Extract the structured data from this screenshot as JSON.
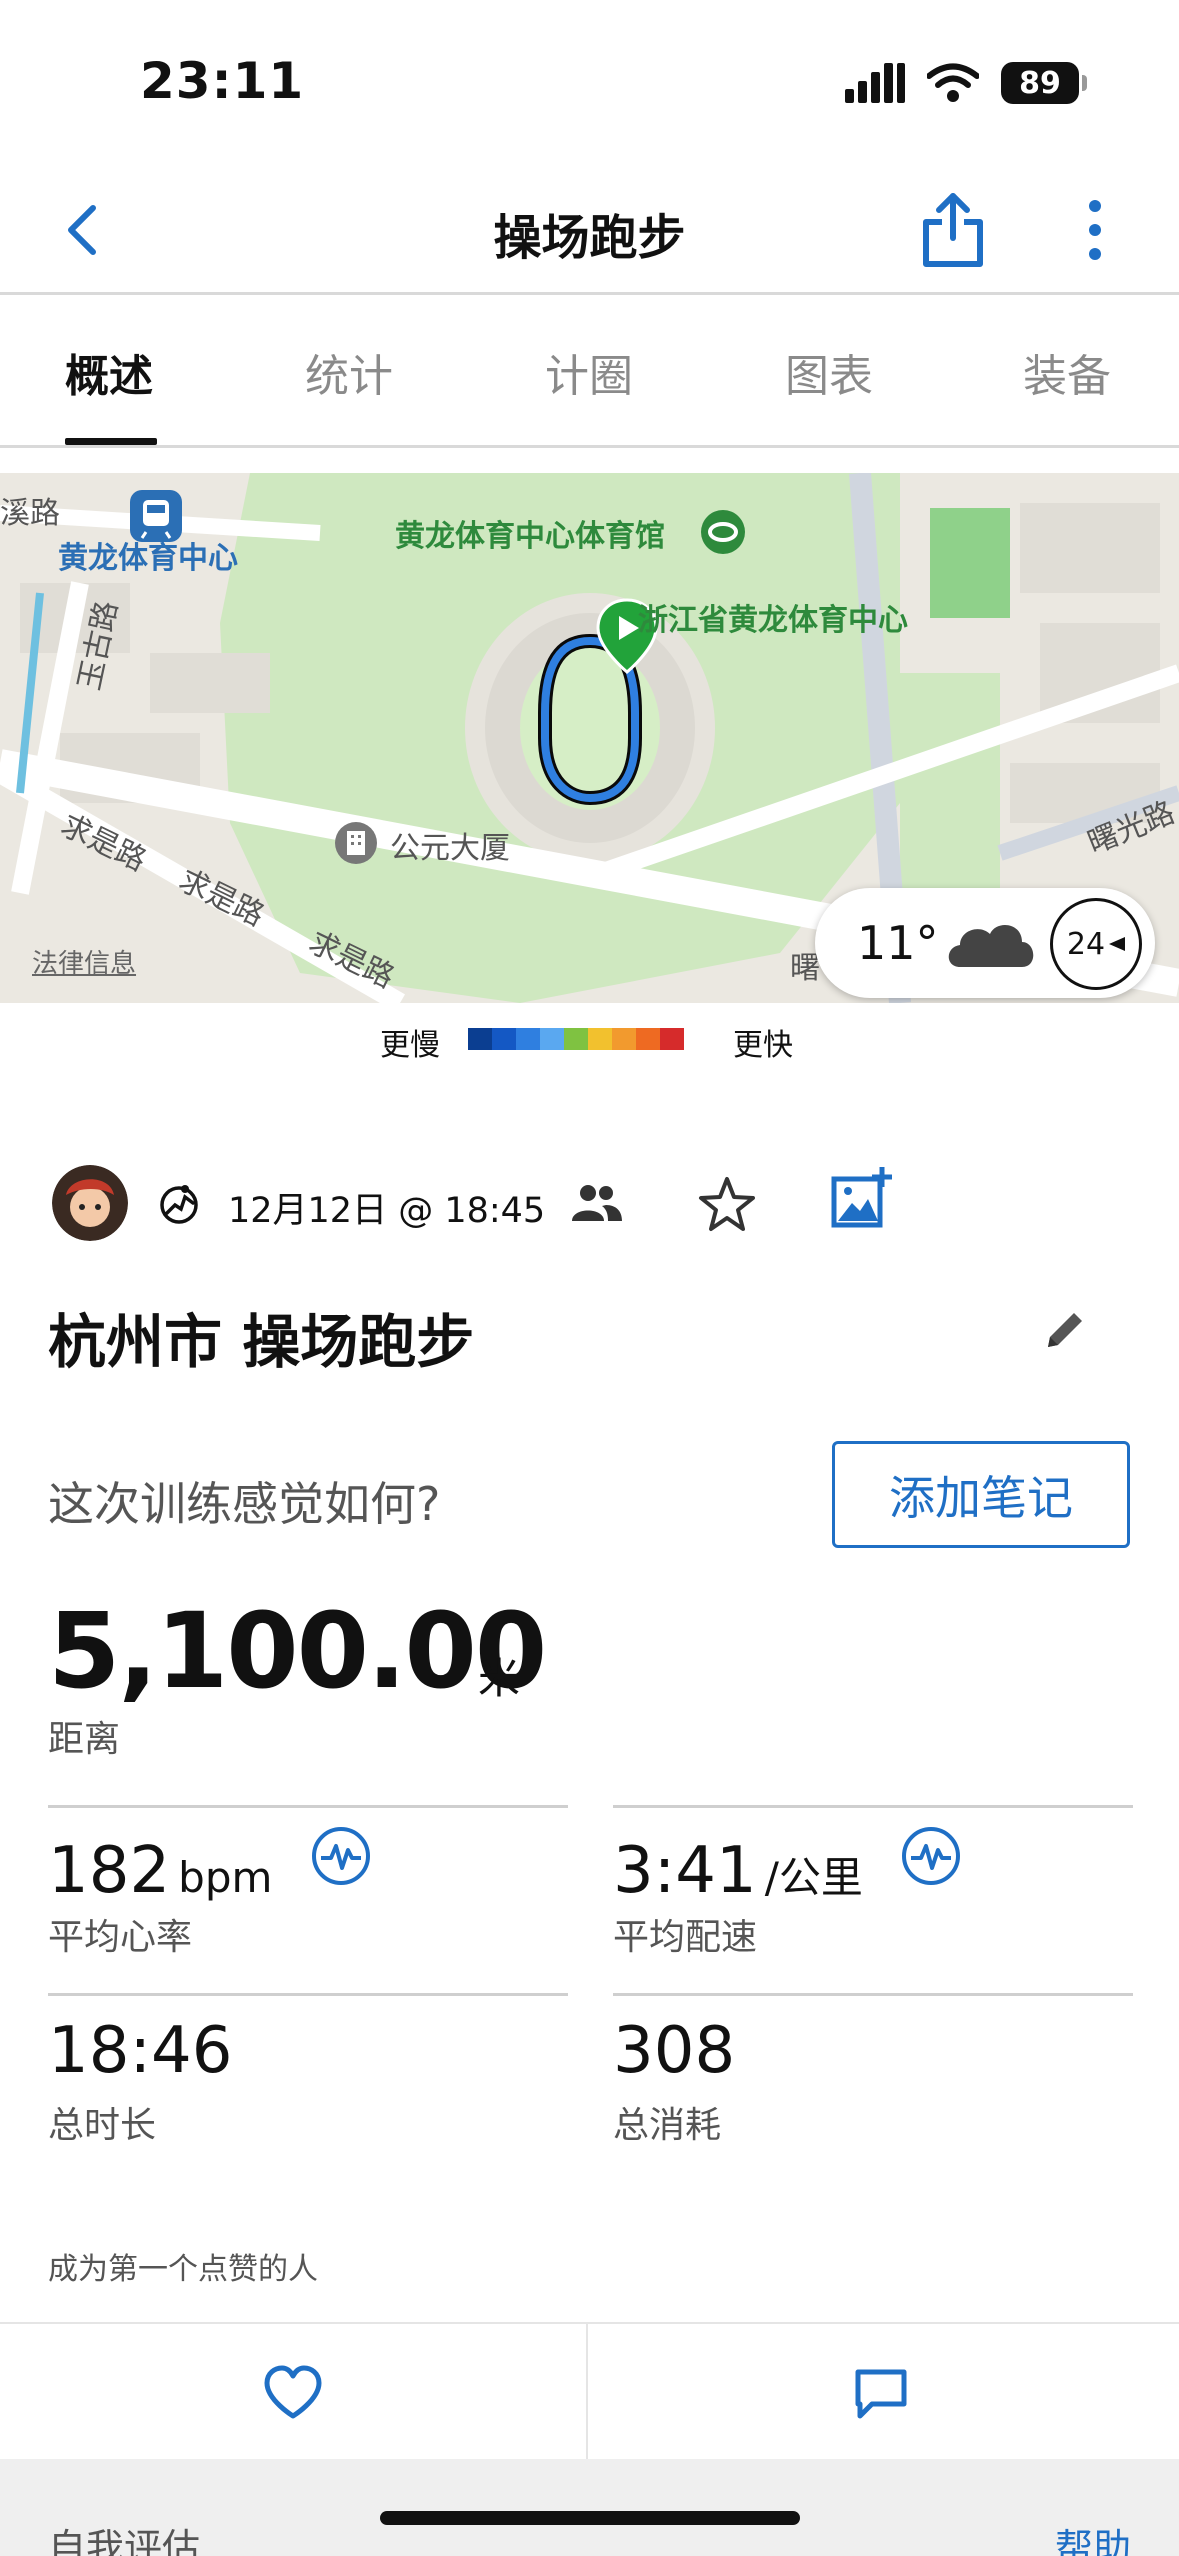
{
  "status_bar": {
    "time": "23:11",
    "battery": "89"
  },
  "nav": {
    "title": "操场跑步"
  },
  "tabs": [
    {
      "label": "概述",
      "active": true
    },
    {
      "label": "统计",
      "active": false
    },
    {
      "label": "计圈",
      "active": false
    },
    {
      "label": "图表",
      "active": false
    },
    {
      "label": "装备",
      "active": false
    }
  ],
  "map": {
    "labels": {
      "stadium_hall": "黄龙体育中心体育馆",
      "metro_station": "黄龙体育中心",
      "sports_center": "浙江省黄龙体育中心",
      "building": "公元大厦",
      "road_qiushi_1": "求是路",
      "road_qiushi_2": "求是路",
      "road_qiushi_3": "求是路",
      "road_yuquan": "玉古路",
      "road_xixi": "溪路",
      "road_shuguang": "曙光路",
      "road_partial": "曙"
    },
    "legal": "法律信息",
    "weather": {
      "temperature": "11°",
      "icon": "cloud-icon",
      "wind": "24"
    }
  },
  "pace_legend": {
    "slow_label": "更慢",
    "fast_label": "更快",
    "colors": [
      "#0b3e91",
      "#1458c4",
      "#2f7fe0",
      "#5aa8f0",
      "#7fc241",
      "#f2c12e",
      "#f29a2e",
      "#ee6a22",
      "#d62b2b"
    ]
  },
  "activity": {
    "date": "12月12日 @ 18:45",
    "title": "杭州市 操场跑步",
    "feeling_question": "这次训练感觉如何?",
    "add_note": "添加笔记",
    "distance": {
      "value": "5,100.00",
      "unit": "米",
      "label": "距离"
    }
  },
  "stats": {
    "heart_rate": {
      "value": "182",
      "unit": "bpm",
      "label": "平均心率"
    },
    "pace": {
      "value": "3:41",
      "unit": "/公里",
      "label": "平均配速"
    },
    "duration": {
      "value": "18:46",
      "label": "总时长"
    },
    "calories": {
      "value": "308",
      "label": "总消耗"
    }
  },
  "social": {
    "likes_text": "成为第一个点赞的人"
  },
  "bottom": {
    "self_eval": "自我评估",
    "help": "帮助"
  },
  "colors": {
    "accent": "#1f6fc5",
    "route": "#2f7fe0",
    "map_green": "#2e8a3c"
  }
}
